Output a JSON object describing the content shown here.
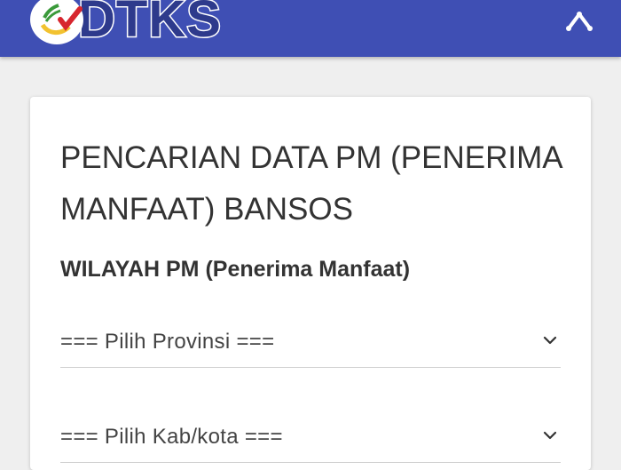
{
  "header": {
    "logo_text": "DTKS",
    "logo_colors": {
      "bar": "#3f4fb4",
      "text": "#2e3a8c",
      "accent_red": "#d7262e",
      "accent_green": "#3a9a3a",
      "accent_yellow": "#f2c230"
    },
    "menu_icon": "chevron-up-icon"
  },
  "card": {
    "title": "PENCARIAN DATA PM (PENERIMA MANFAAT) BANSOS",
    "section_label": "WILAYAH PM (Penerima Manfaat)",
    "selects": [
      {
        "selected": "=== Pilih Provinsi ==="
      },
      {
        "selected": "=== Pilih Kab/kota ==="
      }
    ]
  }
}
